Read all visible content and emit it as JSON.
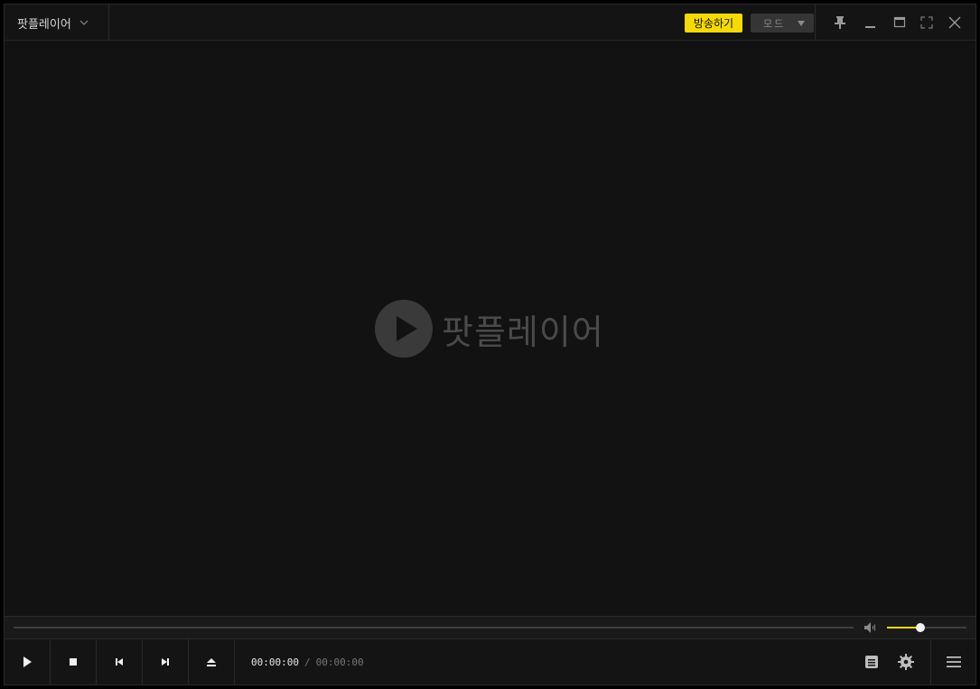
{
  "titlebar": {
    "app_menu_label": "팟플레이어",
    "broadcast_label": "방송하기",
    "mode_label": "모드"
  },
  "video": {
    "logo_text": "팟플레이어"
  },
  "playback": {
    "current_time": "00:00:00",
    "separator": "/",
    "total_time": "00:00:00",
    "volume_level": 0.42
  },
  "colors": {
    "accent": "#f5d90a",
    "background": "#121212",
    "panel": "#141414"
  },
  "icons": {
    "app_menu": "chevron-down-icon",
    "mode": "caret-down-icon",
    "window": [
      "pin-icon",
      "minimize-icon",
      "maximize-icon",
      "fullscreen-icon",
      "close-icon"
    ],
    "controls": [
      "play-icon",
      "stop-icon",
      "previous-icon",
      "next-icon",
      "eject-icon"
    ],
    "right": [
      "playlist-icon",
      "settings-icon",
      "menu-icon"
    ],
    "volume": "speaker-icon"
  }
}
